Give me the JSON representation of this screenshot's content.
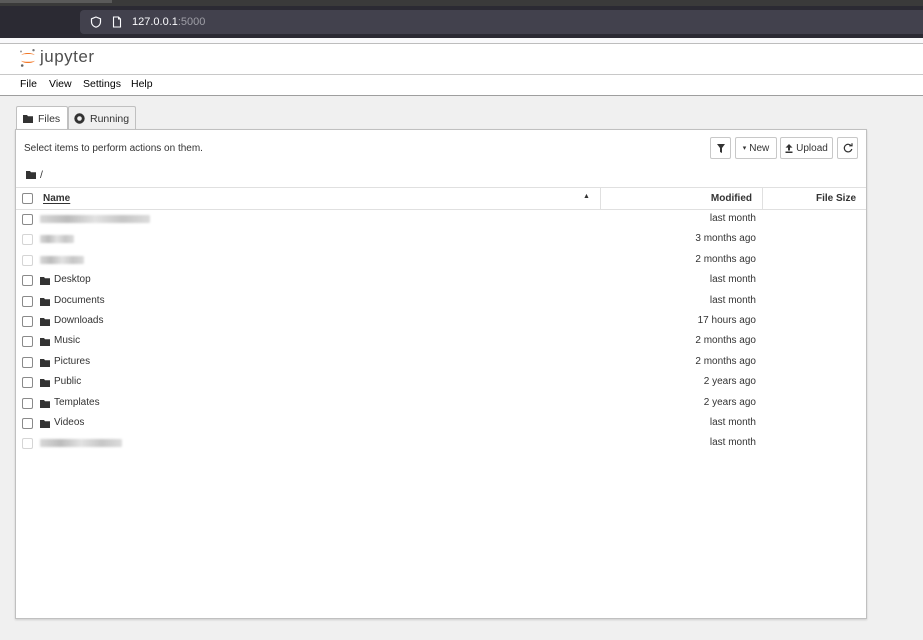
{
  "browser": {
    "url_host": "127.0.0.1",
    "url_port": ":5000"
  },
  "app": {
    "logo_text": "jupyter"
  },
  "menu": [
    "File",
    "View",
    "Settings",
    "Help"
  ],
  "tabs": [
    {
      "label": "Files",
      "icon": "folder-icon",
      "active": true
    },
    {
      "label": "Running",
      "icon": "running-icon",
      "active": false
    }
  ],
  "toolbar": {
    "hint": "Select items to perform actions on them.",
    "new_label": "New",
    "upload_label": "Upload"
  },
  "breadcrumb": "/",
  "table": {
    "columns": {
      "name": "Name",
      "modified": "Modified",
      "size": "File Size"
    },
    "rows": [
      {
        "name": "",
        "modified": "last month",
        "redacted": true
      },
      {
        "name": "",
        "modified": "3 months ago",
        "redacted": true
      },
      {
        "name": "",
        "modified": "2 months ago",
        "redacted": true
      },
      {
        "name": "Desktop",
        "modified": "last month",
        "redacted": false
      },
      {
        "name": "Documents",
        "modified": "last month",
        "redacted": false
      },
      {
        "name": "Downloads",
        "modified": "17 hours ago",
        "redacted": false
      },
      {
        "name": "Music",
        "modified": "2 months ago",
        "redacted": false
      },
      {
        "name": "Pictures",
        "modified": "2 months ago",
        "redacted": false
      },
      {
        "name": "Public",
        "modified": "2 years ago",
        "redacted": false
      },
      {
        "name": "Templates",
        "modified": "2 years ago",
        "redacted": false
      },
      {
        "name": "Videos",
        "modified": "last month",
        "redacted": false
      },
      {
        "name": "",
        "modified": "last month",
        "redacted": true
      }
    ]
  },
  "colors": {
    "accent": "#f37726",
    "chrome": "#2b2a33"
  }
}
